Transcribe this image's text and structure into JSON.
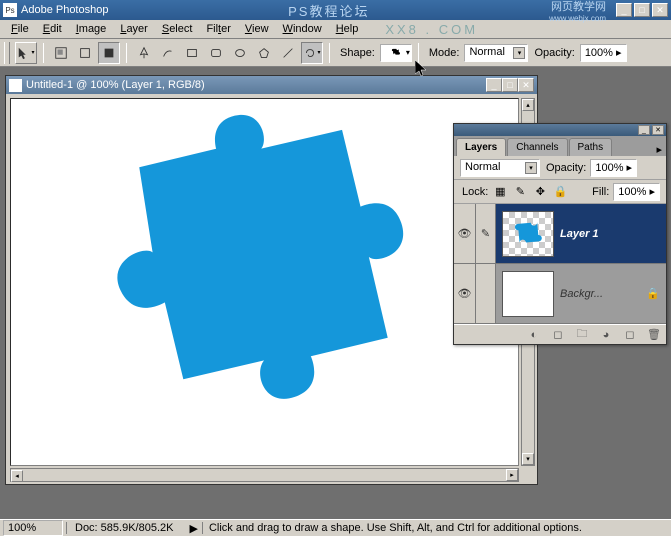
{
  "titlebar": {
    "app_name": "Adobe Photoshop",
    "center": "PS教程论坛",
    "watermark": "网页教学网",
    "watermark_url": "www.webjx.com"
  },
  "menu": {
    "file": "File",
    "edit": "Edit",
    "image": "Image",
    "layer": "Layer",
    "select": "Select",
    "filter": "Filter",
    "view": "View",
    "window": "Window",
    "help": "Help",
    "overlay": "XX8 . COM"
  },
  "options": {
    "shape_label": "Shape:",
    "mode_label": "Mode:",
    "mode_value": "Normal",
    "opacity_label": "Opacity:",
    "opacity_value": "100%"
  },
  "document": {
    "title": "Untitled-1 @ 100% (Layer 1, RGB/8)"
  },
  "layers_panel": {
    "tabs": {
      "layers": "Layers",
      "channels": "Channels",
      "paths": "Paths"
    },
    "blend_mode": "Normal",
    "opacity_label": "Opacity:",
    "opacity_value": "100%",
    "lock_label": "Lock:",
    "fill_label": "Fill:",
    "fill_value": "100%",
    "layers": [
      {
        "name": "Layer 1",
        "visible": true,
        "selected": true
      },
      {
        "name": "Backgr...",
        "visible": true,
        "selected": false,
        "locked": true
      }
    ]
  },
  "status": {
    "zoom": "100%",
    "doc": "Doc: 585.9K/805.2K",
    "hint": "Click and drag to draw a shape.  Use Shift, Alt, and Ctrl for additional options."
  },
  "colors": {
    "shape_fill": "#1597DA"
  }
}
